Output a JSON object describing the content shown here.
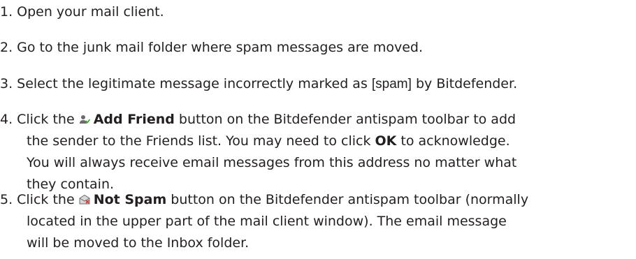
{
  "steps": [
    {
      "num": "1.",
      "text": "Open your mail client."
    },
    {
      "num": "2.",
      "text": "Go to the junk mail folder where spam messages are moved."
    },
    {
      "num": "3.",
      "text_before": "Select the legitimate message incorrectly marked as",
      "tag": "[spam]",
      "text_after": "by Bitdefender."
    },
    {
      "num": "4.",
      "pre": "Click the",
      "icon": "add-friend-icon",
      "button": "Add Friend",
      "mid": "button on the Bitdefender antispam toolbar to add",
      "line2_pre": "the sender to the Friends list. You may need to click",
      "ok": "OK",
      "line2_post": "to acknowledge.",
      "line3": "You will always receive email messages from this address no matter what",
      "line4": "they contain."
    },
    {
      "num": "5.",
      "pre": "Click the",
      "icon": "not-spam-icon",
      "button": "Not Spam",
      "mid": "button on the Bitdefender antispam toolbar (normally",
      "line2": "located in the upper part of the mail client window). The email message",
      "line3": "will be moved to the Inbox folder."
    }
  ]
}
